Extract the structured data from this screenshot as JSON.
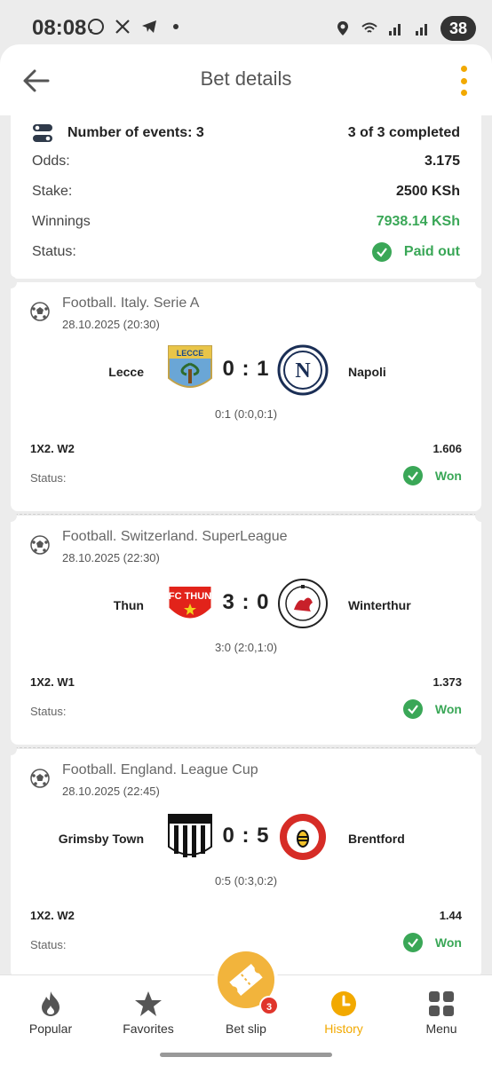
{
  "status_bar": {
    "time": "08:08",
    "battery": "38"
  },
  "header": {
    "title": "Bet details"
  },
  "summary": {
    "events_label": "Number of events: 3",
    "completed": "3 of 3 completed",
    "odds_label": "Odds:",
    "odds_value": "3.175",
    "stake_label": "Stake:",
    "stake_value": "2500 KSh",
    "winnings_label": "Winnings",
    "winnings_value": "7938.14 KSh",
    "status_label": "Status:",
    "status_value": "Paid out"
  },
  "events": [
    {
      "league": "Football. Italy. Serie A",
      "date": "28.10.2025 (20:30)",
      "home": "Lecce",
      "away": "Napoli",
      "score": "0 : 1",
      "detail": "0:1 (0:0,0:1)",
      "market": "1X2. W2",
      "coef": "1.606",
      "status_label": "Status:",
      "status_value": "Won"
    },
    {
      "league": "Football. Switzerland. SuperLeague",
      "date": "28.10.2025 (22:30)",
      "home": "Thun",
      "away": "Winterthur",
      "score": "3 : 0",
      "detail": "3:0 (2:0,1:0)",
      "market": "1X2. W1",
      "coef": "1.373",
      "status_label": "Status:",
      "status_value": "Won"
    },
    {
      "league": "Football. England. League Cup",
      "date": "28.10.2025 (22:45)",
      "home": "Grimsby Town",
      "away": "Brentford",
      "score": "0 : 5",
      "detail": "0:5 (0:3,0:2)",
      "market": "1X2. W2",
      "coef": "1.44",
      "status_label": "Status:",
      "status_value": "Won"
    }
  ],
  "bottom_nav": {
    "popular": "Popular",
    "favorites": "Favorites",
    "betslip": "Bet slip",
    "betslip_count": "3",
    "history": "History",
    "menu": "Menu"
  },
  "colors": {
    "accent": "#f2a900",
    "success": "#3aa757",
    "badge": "#e0352b"
  },
  "icons": [
    "back-arrow-icon",
    "more-vert-icon",
    "toggle-icon",
    "check-circle-icon",
    "soccer-ball-icon",
    "fire-icon",
    "star-icon",
    "ticket-icon",
    "clock-icon",
    "grid-icon"
  ]
}
